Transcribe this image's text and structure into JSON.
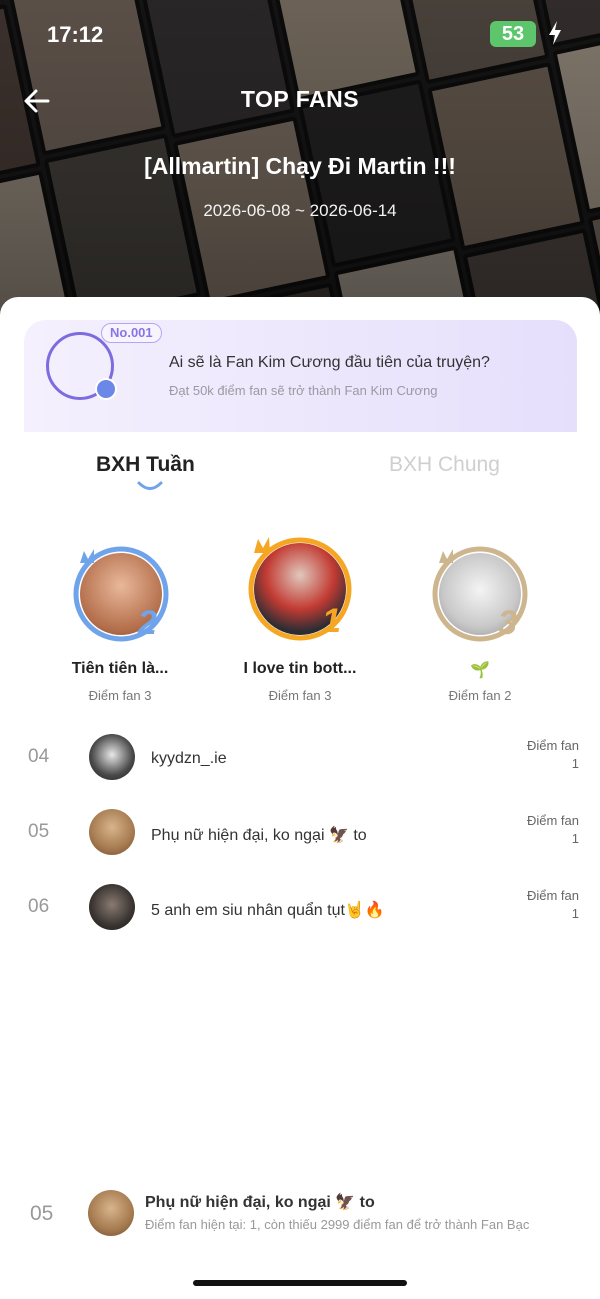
{
  "status_bar": {
    "time": "17:12",
    "battery": "53"
  },
  "header": {
    "title": "TOP FANS",
    "comic_title": "[Allmartin] Chạy Đi Martin !!!",
    "date_range": "2026-06-08 ~ 2026-06-14"
  },
  "promo": {
    "badge": "No.001",
    "title": "Ai sẽ là Fan Kim Cương đầu tiên của truyện?",
    "subtitle": "Đạt 50k điểm fan sẽ trở thành Fan Kim Cương"
  },
  "tabs": [
    {
      "label": "BXH Tuần",
      "active": true
    },
    {
      "label": "BXH Chung",
      "active": false
    }
  ],
  "podium": [
    {
      "rank": "2",
      "name": "Tiên tiên là...",
      "score": "Điểm fan 3"
    },
    {
      "rank": "1",
      "name": "I love tin bott...",
      "score": "Điểm fan 3"
    },
    {
      "rank": "3",
      "name": "🌱",
      "score": "Điểm fan 2"
    }
  ],
  "list": [
    {
      "rank": "04",
      "name": "kyydzn_.ie",
      "score_label": "Điểm fan",
      "score": "1"
    },
    {
      "rank": "05",
      "name": "Phụ nữ hiện đại, ko ngại 🦅 to",
      "score_label": "Điểm fan",
      "score": "1"
    },
    {
      "rank": "06",
      "name": "5 anh em siu nhân quẩn tụt🤘🔥",
      "score_label": "Điểm fan",
      "score": "1"
    }
  ],
  "my_rank": {
    "rank": "05",
    "name": "Phụ nữ hiện đại, ko ngại 🦅 to",
    "detail": "Điểm fan hiện tại: 1, còn thiếu 2999 điểm fan để trở thành Fan Bạc"
  },
  "colors": {
    "accent_purple": "#7b6ce0",
    "rank1_gold": "#f5a623",
    "rank2_blue": "#6fa3ea",
    "rank3_beige": "#cdb68e",
    "battery_green": "#5dc56b"
  }
}
